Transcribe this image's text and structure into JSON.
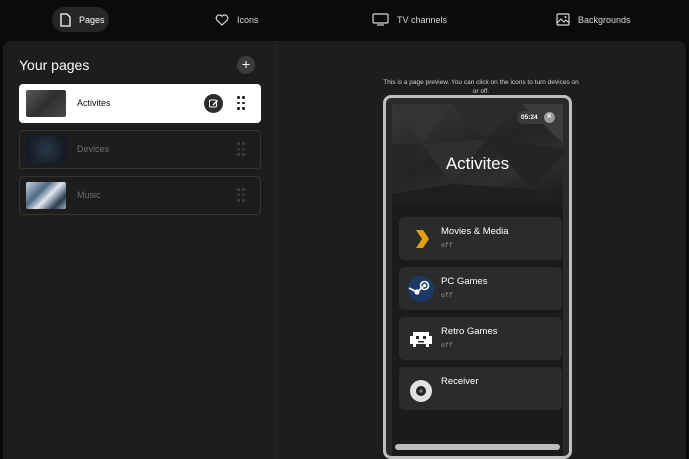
{
  "nav": {
    "items": [
      {
        "label": "Pages",
        "icon": "page-icon",
        "active": true
      },
      {
        "label": "Icons",
        "icon": "heart-icon",
        "active": false
      },
      {
        "label": "TV channels",
        "icon": "tv-icon",
        "active": false
      },
      {
        "label": "Backgrounds",
        "icon": "image-icon",
        "active": false
      }
    ]
  },
  "sidebar": {
    "title": "Your pages",
    "add_label": "+",
    "pages": [
      {
        "label": "Activites",
        "selected": true
      },
      {
        "label": "Devices",
        "selected": false
      },
      {
        "label": "Music",
        "selected": false
      }
    ]
  },
  "preview": {
    "note": "This is a page preview. You can click on the icons to turn devices on or off.",
    "time": "05:24",
    "avatar_letter": "K",
    "page_title": "Activites",
    "cards": [
      {
        "title": "Movies & Media",
        "state": "off",
        "icon": "plex-icon"
      },
      {
        "title": "PC Games",
        "state": "off",
        "icon": "steam-icon"
      },
      {
        "title": "Retro Games",
        "state": "off",
        "icon": "retro-controller-icon"
      },
      {
        "title": "Receiver",
        "state": "",
        "icon": "receiver-icon"
      }
    ]
  },
  "colors": {
    "background": "#0b0b0b",
    "panel": "#1c1d1c",
    "accent_plex": "#e5a00d",
    "accent_steam": "#1b2838"
  }
}
